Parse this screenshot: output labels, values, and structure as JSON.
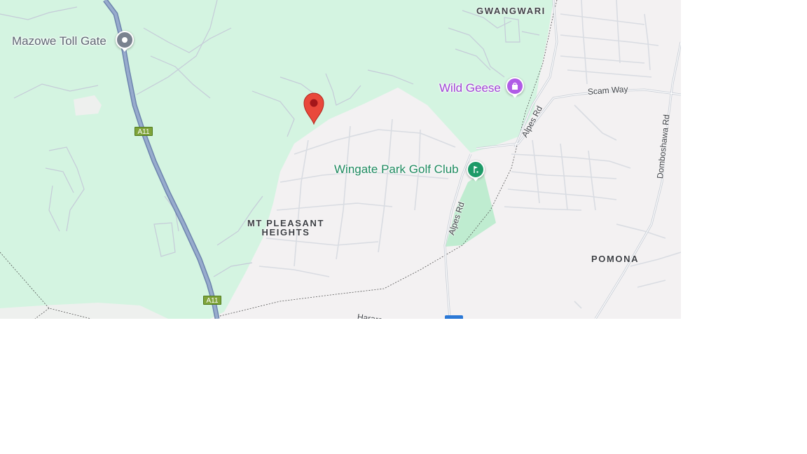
{
  "map": {
    "area_labels": [
      {
        "id": "gwangwari",
        "text": "GWANGWARI"
      },
      {
        "id": "mt-pleasant-heights",
        "line1": "MT PLEASANT",
        "line2": "HEIGHTS"
      },
      {
        "id": "pomona",
        "text": "POMONA"
      }
    ],
    "pois": [
      {
        "id": "mazowe-toll-gate",
        "label": "Mazowe Toll Gate",
        "color": "#5f6673",
        "icon": "toll-gate-icon"
      },
      {
        "id": "wild-geese",
        "label": "Wild Geese",
        "color": "#a142d6",
        "icon": "shopping-bag-icon"
      },
      {
        "id": "wingate-park-golf-club",
        "label": "Wingate Park Golf Club",
        "color": "#1e8a5f",
        "icon": "golf-icon"
      }
    ],
    "roads": [
      {
        "id": "scam-way",
        "label": "Scam Way"
      },
      {
        "id": "alpes-rd-north",
        "label": "Alpes Rd"
      },
      {
        "id": "alpes-rd-south",
        "label": "Alpes Rd"
      },
      {
        "id": "domboshawa-rd",
        "label": "Domboshawa Rd"
      },
      {
        "id": "harare",
        "label": "Harare"
      }
    ],
    "route_shields": [
      {
        "id": "a11-north",
        "label": "A11"
      },
      {
        "id": "a11-south",
        "label": "A11"
      }
    ],
    "marker": {
      "icon": "location-pin-icon",
      "color": "#e9483b"
    },
    "colors": {
      "park_green": "#d4f4e1",
      "urban_grey": "#f3f1f2",
      "highway": "#8fa4c7",
      "road": "#c9ced6",
      "golf_green": "#bfecd0"
    }
  }
}
